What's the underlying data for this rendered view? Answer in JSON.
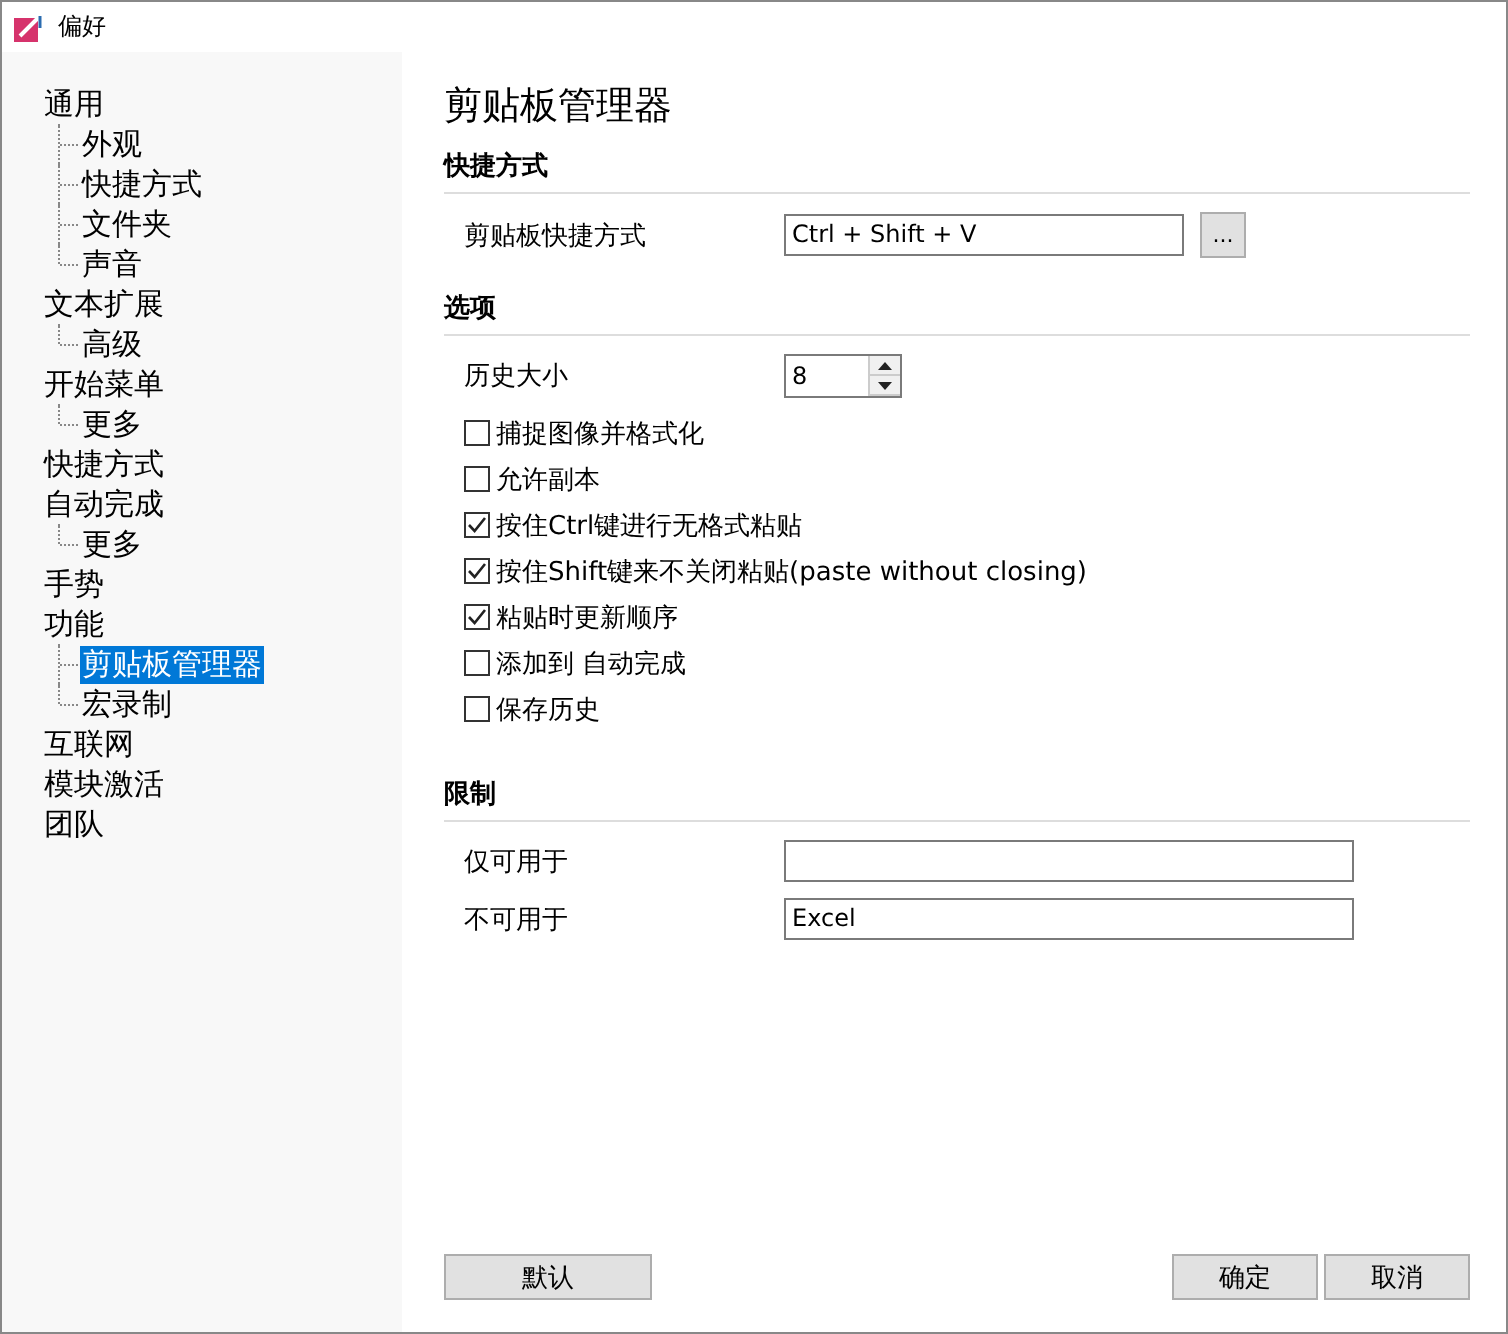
{
  "window": {
    "title": "偏好"
  },
  "sidebar": {
    "items": [
      {
        "label": "通用",
        "selected": false,
        "children": [
          {
            "label": "外观",
            "selected": false
          },
          {
            "label": "快捷方式",
            "selected": false
          },
          {
            "label": "文件夹",
            "selected": false
          },
          {
            "label": "声音",
            "selected": false
          }
        ]
      },
      {
        "label": "文本扩展",
        "selected": false,
        "children": [
          {
            "label": "高级",
            "selected": false
          }
        ]
      },
      {
        "label": "开始菜单",
        "selected": false,
        "children": [
          {
            "label": "更多",
            "selected": false
          }
        ]
      },
      {
        "label": "快捷方式",
        "selected": false
      },
      {
        "label": "自动完成",
        "selected": false,
        "children": [
          {
            "label": "更多",
            "selected": false
          }
        ]
      },
      {
        "label": "手势",
        "selected": false
      },
      {
        "label": "功能",
        "selected": false,
        "children": [
          {
            "label": "剪贴板管理器",
            "selected": true
          },
          {
            "label": "宏录制",
            "selected": false
          }
        ]
      },
      {
        "label": "互联网",
        "selected": false
      },
      {
        "label": "模块激活",
        "selected": false
      },
      {
        "label": "团队",
        "selected": false
      }
    ]
  },
  "page": {
    "title": "剪贴板管理器",
    "shortcut_section": {
      "heading": "快捷方式",
      "label": "剪贴板快捷方式",
      "value": "Ctrl + Shift + V",
      "button": "..."
    },
    "options_section": {
      "heading": "选项",
      "history_label": "历史大小",
      "history_value": "8",
      "checkboxes": [
        {
          "label": "捕捉图像并格式化",
          "checked": false
        },
        {
          "label": "允许副本",
          "checked": false
        },
        {
          "label": "按住Ctrl键进行无格式粘贴",
          "checked": true
        },
        {
          "label": "按住Shift键来不关闭粘贴(paste without closing)",
          "checked": true
        },
        {
          "label": "粘贴时更新顺序",
          "checked": true
        },
        {
          "label": "添加到 自动完成",
          "checked": false
        },
        {
          "label": "保存历史",
          "checked": false
        }
      ]
    },
    "restrict_section": {
      "heading": "限制",
      "fields": [
        {
          "label": "仅可用于"
        },
        {
          "label": "不可用于",
          "value": "Excel"
        }
      ]
    }
  },
  "buttons": {
    "default": "默认",
    "ok": "确定",
    "cancel": "取消"
  }
}
